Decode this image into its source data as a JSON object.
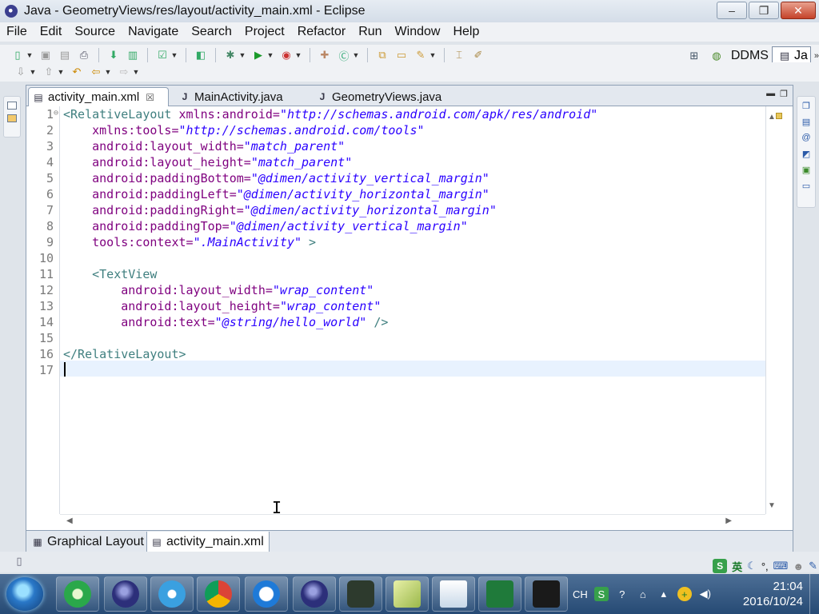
{
  "window": {
    "title": "Java - GeometryViews/res/layout/activity_main.xml - Eclipse",
    "minimize": "–",
    "maximize": "❐",
    "close": "✕"
  },
  "menu": [
    "File",
    "Edit",
    "Source",
    "Navigate",
    "Search",
    "Project",
    "Refactor",
    "Run",
    "Window",
    "Help"
  ],
  "perspectives": {
    "ddms_label": "DDMS",
    "java_label": "Ja"
  },
  "editor_tabs": [
    {
      "label": "activity_main.xml",
      "active": true,
      "icon": "xml-file-icon"
    },
    {
      "label": "MainActivity.java",
      "active": false,
      "icon": "java-file-icon"
    },
    {
      "label": "GeometryViews.java",
      "active": false,
      "icon": "java-file-icon"
    }
  ],
  "code": {
    "line_numbers": [
      "1",
      "2",
      "3",
      "4",
      "5",
      "6",
      "7",
      "8",
      "9",
      "10",
      "11",
      "12",
      "13",
      "14",
      "15",
      "16",
      "17"
    ],
    "lines": {
      "l1": {
        "tag": "<RelativeLayout",
        "attr": " xmlns:android=",
        "val": "\"http://schemas.android.com/apk/res/android\""
      },
      "l2": {
        "attr": "    xmlns:tools=",
        "val": "\"http://schemas.android.com/tools\""
      },
      "l3": {
        "attr": "    android:layout_width=",
        "val": "\"match_parent\""
      },
      "l4": {
        "attr": "    android:layout_height=",
        "val": "\"match_parent\""
      },
      "l5": {
        "attr": "    android:paddingBottom=",
        "val": "\"@dimen/activity_vertical_margin\""
      },
      "l6": {
        "attr": "    android:paddingLeft=",
        "val": "\"@dimen/activity_horizontal_margin\""
      },
      "l7": {
        "attr": "    android:paddingRight=",
        "val": "\"@dimen/activity_horizontal_margin\""
      },
      "l8": {
        "attr": "    android:paddingTop=",
        "val": "\"@dimen/activity_vertical_margin\""
      },
      "l9": {
        "attr": "    tools:context=",
        "val": "\".MainActivity\"",
        "tag_end": " >"
      },
      "l11": {
        "tag": "    <TextView"
      },
      "l12": {
        "attr": "        android:layout_width=",
        "val": "\"wrap_content\""
      },
      "l13": {
        "attr": "        android:layout_height=",
        "val": "\"wrap_content\""
      },
      "l14": {
        "attr": "        android:text=",
        "val": "\"@string/hello_world\"",
        "tag_end": " />"
      },
      "l16": {
        "tag": "</RelativeLayout>"
      }
    }
  },
  "bottom_tabs": [
    {
      "label": "Graphical Layout",
      "active": false
    },
    {
      "label": "activity_main.xml",
      "active": true
    }
  ],
  "ime": {
    "s_label": "S",
    "lang": "英"
  },
  "tray": {
    "lang": "CH",
    "time": "21:04",
    "date": "2016/10/24"
  },
  "colors": {
    "xml_tag": "#3f7f7f",
    "xml_attr": "#7f007f",
    "xml_value": "#2a00ff",
    "current_line": "#e8f2fe"
  }
}
